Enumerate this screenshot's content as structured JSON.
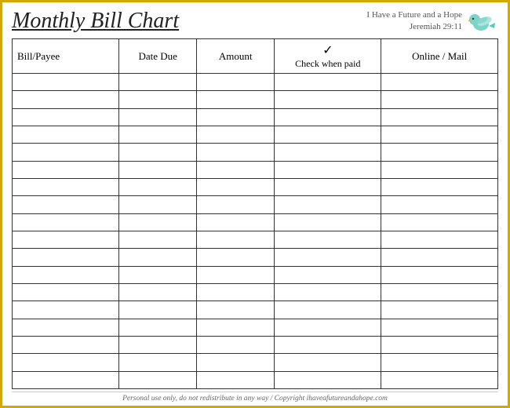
{
  "header": {
    "title": "Monthly Bill Chart",
    "tagline_line1": "I Have a Future and a Hope",
    "tagline_line2": "Jeremiah 29:11"
  },
  "table": {
    "columns": [
      {
        "key": "bill",
        "label": "Bill/Payee"
      },
      {
        "key": "date",
        "label": "Date Due"
      },
      {
        "key": "amount",
        "label": "Amount"
      },
      {
        "key": "check",
        "label": "Check when paid",
        "check_symbol": "✓"
      },
      {
        "key": "online",
        "label": "Online / Mail"
      }
    ],
    "row_count": 18
  },
  "footer": {
    "text": "Personal use only, do not redistribute in any way / Copyright ihaveafutureandahope.com"
  }
}
